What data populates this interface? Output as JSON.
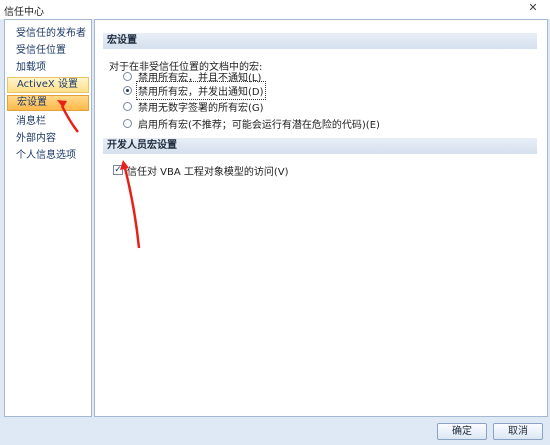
{
  "window": {
    "title": "信任中心",
    "close_label": "✕"
  },
  "sidebar": {
    "items": [
      {
        "label": "受信任的发布者"
      },
      {
        "label": "受信任位置"
      },
      {
        "label": "加载项"
      },
      {
        "label": "ActiveX 设置"
      },
      {
        "label": "宏设置"
      },
      {
        "label": "消息栏"
      },
      {
        "label": "外部内容"
      },
      {
        "label": "个人信息选项"
      }
    ]
  },
  "macro": {
    "header": "宏设置",
    "description": "对于在非受信任位置的文档中的宏:",
    "options": [
      {
        "label": "禁用所有宏，并且不通知(L)",
        "checked": false
      },
      {
        "label": "禁用所有宏，并发出通知(D)",
        "checked": true
      },
      {
        "label": "禁用无数字签署的所有宏(G)",
        "checked": false
      },
      {
        "label": "启用所有宏(不推荐；可能会运行有潜在危险的代码)(E)",
        "checked": false
      }
    ]
  },
  "developer": {
    "header": "开发人员宏设置",
    "vba_label": "信任对 VBA 工程对象模型的访问(V)",
    "vba_checked": true,
    "check_mark": "✓"
  },
  "buttons": {
    "ok": "确定",
    "cancel": "取消"
  },
  "colors": {
    "annotation_arrow": "#e8201a",
    "active_nav": "#ffb84a",
    "section_header": "#d5e0ee"
  }
}
